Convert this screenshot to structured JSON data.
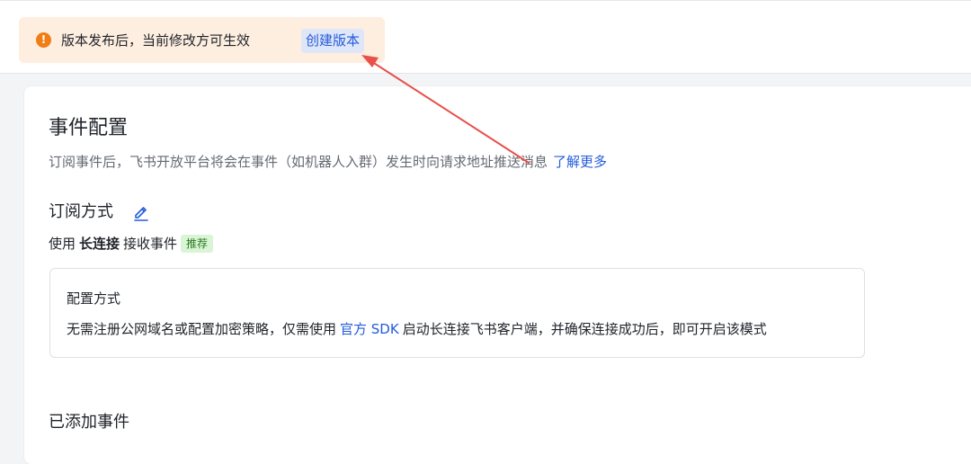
{
  "notice": {
    "icon": "warning-icon",
    "icon_glyph": "!",
    "text": "版本发布后，当前修改方可生效",
    "create_link": "创建版本",
    "colors": {
      "background": "#fdeee0",
      "icon": "#f07d16",
      "link": "#245bdb"
    }
  },
  "event_config": {
    "title": "事件配置",
    "subtitle": "订阅事件后，飞书开放平台将会在事件（如机器人入群）发生时向请求地址推送消息",
    "learn_more": "了解更多",
    "subscription_mode": {
      "label": "订阅方式",
      "edit_icon": "edit-pencil-icon",
      "usage_prefix": "使用",
      "usage_method": "长连接",
      "usage_suffix": "接收事件",
      "badge": "推荐"
    },
    "config_box": {
      "title": "配置方式",
      "desc_prefix": "无需注册公网域名或配置加密策略，仅需使用",
      "desc_link": "官方 SDK",
      "desc_suffix": "启动长连接飞书客户端，并确保连接成功后，即可开启该模式"
    },
    "added_events_title": "已添加事件"
  }
}
